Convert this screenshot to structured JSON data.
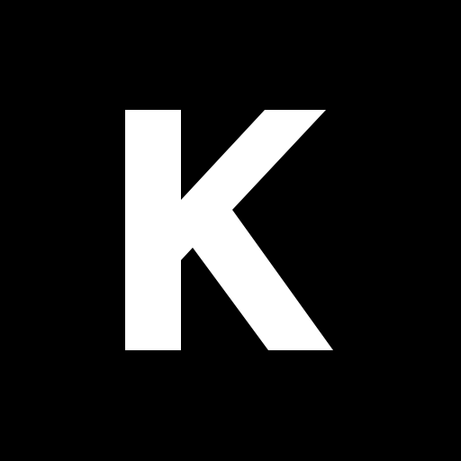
{
  "icon": {
    "name": "letter-k-logo-icon",
    "text": "K",
    "background_color": "#000000",
    "foreground_color": "#ffffff"
  }
}
